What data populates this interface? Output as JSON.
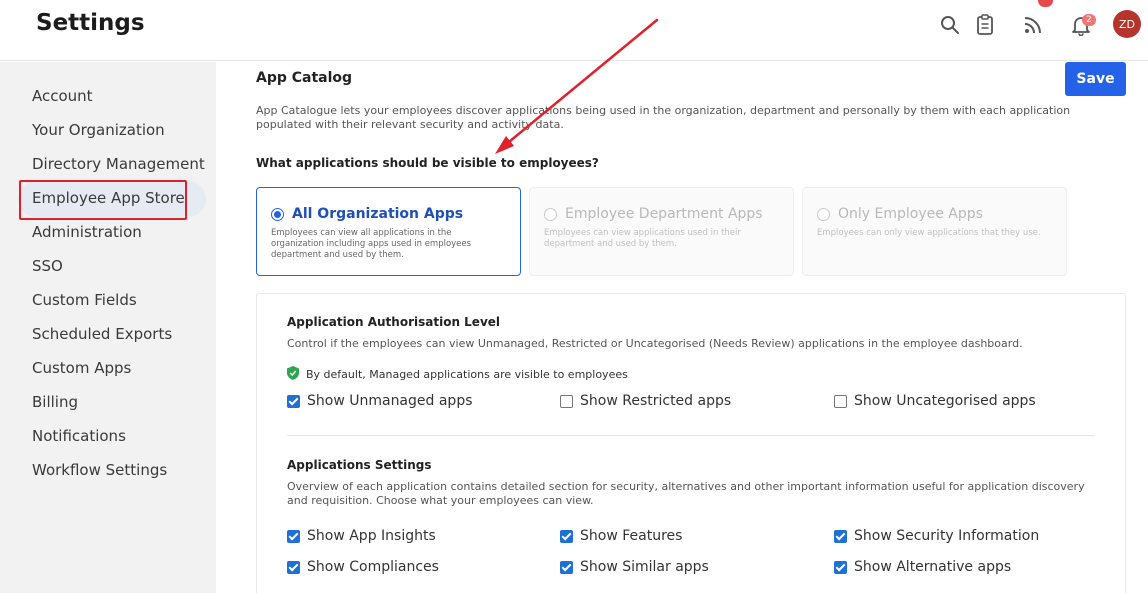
{
  "header": {
    "title": "Settings",
    "icons": [
      "search-icon",
      "clipboard-icon",
      "rss-icon",
      "bell-icon"
    ],
    "notification_count": "2",
    "avatar_initials": "ZD"
  },
  "sidebar": {
    "items": [
      {
        "label": "Account"
      },
      {
        "label": "Your Organization"
      },
      {
        "label": "Directory Management"
      },
      {
        "label": "Employee App Store",
        "active": true
      },
      {
        "label": "Administration"
      },
      {
        "label": "SSO"
      },
      {
        "label": "Custom Fields"
      },
      {
        "label": "Scheduled Exports"
      },
      {
        "label": "Custom Apps"
      },
      {
        "label": "Billing"
      },
      {
        "label": "Notifications"
      },
      {
        "label": "Workflow Settings"
      }
    ]
  },
  "main": {
    "title": "App Catalog",
    "save_label": "Save",
    "description": "App Catalogue lets your employees discover applications being used in the organization, department and personally by them with each application populated with their relevant security and activity data.",
    "question": "What applications should be visible to employees?",
    "visibility_options": [
      {
        "title": "All Organization Apps",
        "description": "Employees can view all applications in the organization including apps used in employees department and used by them.",
        "selected": true
      },
      {
        "title": "Employee Department Apps",
        "description": "Employees can view applications used in their department and used by them.",
        "selected": false
      },
      {
        "title": "Only Employee Apps",
        "description": "Employees can only view applications that they use.",
        "selected": false
      }
    ],
    "authorisation": {
      "title": "Application Authorisation Level",
      "description": "Control if the employees can view Unmanaged, Restricted or Uncategorised (Needs Review) applications in the employee dashboard.",
      "default_note": "By default, Managed applications are visible to employees",
      "options": [
        {
          "label": "Show Unmanaged apps",
          "checked": true
        },
        {
          "label": "Show Restricted apps",
          "checked": false
        },
        {
          "label": "Show Uncategorised apps",
          "checked": false
        }
      ]
    },
    "app_settings": {
      "title": "Applications Settings",
      "description": "Overview of each application contains detailed section for security, alternatives and other important information useful for application discovery and requisition. Choose what your employees can view.",
      "options": [
        {
          "label": "Show App Insights",
          "checked": true
        },
        {
          "label": "Show Features",
          "checked": true
        },
        {
          "label": "Show Security Information",
          "checked": true
        },
        {
          "label": "Show Compliances",
          "checked": true
        },
        {
          "label": "Show Similar apps",
          "checked": true
        },
        {
          "label": "Show Alternative apps",
          "checked": true
        }
      ]
    }
  },
  "colors": {
    "accent": "#2463e8",
    "annotation": "#e0202a",
    "avatar": "#b5342b"
  }
}
